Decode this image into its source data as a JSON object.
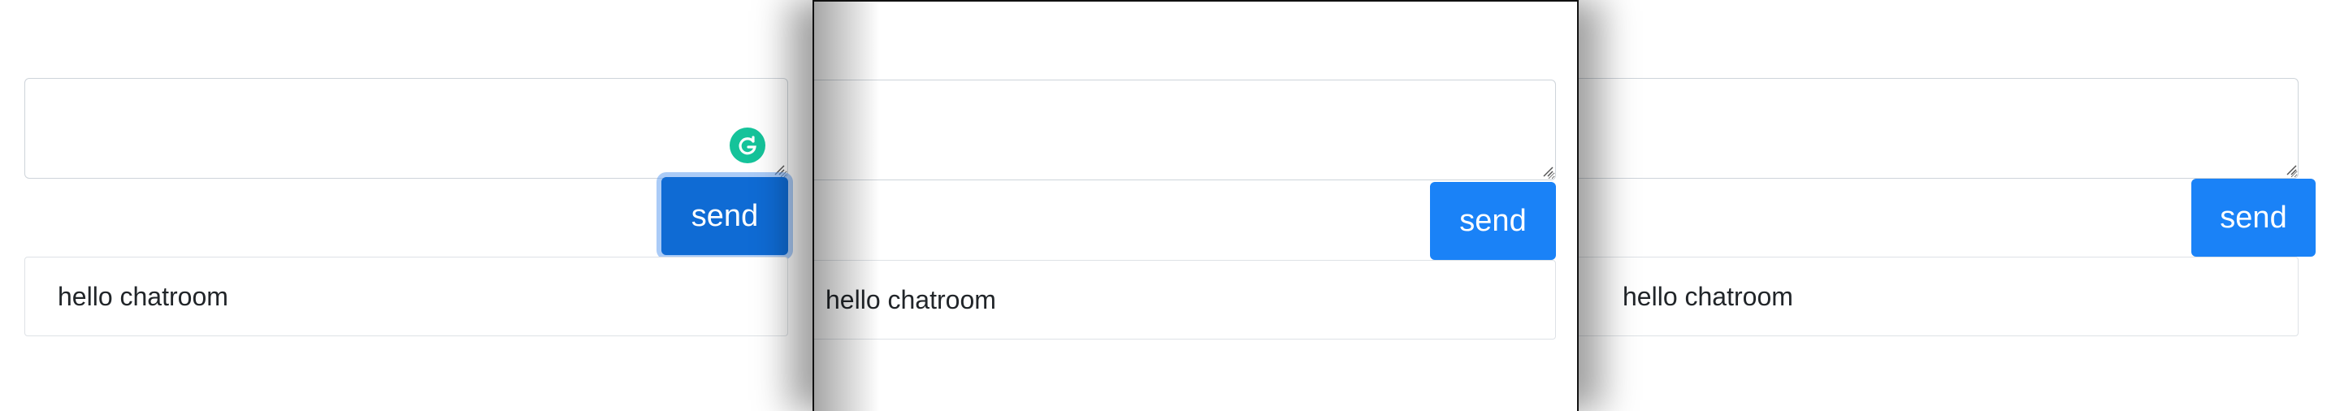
{
  "panels": [
    {
      "send_label": "send",
      "message": "hello chatroom",
      "input_value": "",
      "send_state": "focused"
    },
    {
      "send_label": "send",
      "message": "hello chatroom",
      "input_value": ""
    },
    {
      "send_label": "send",
      "message": "hello chatroom",
      "input_value": ""
    }
  ],
  "colors": {
    "send_button": "#1a82f7",
    "send_button_focused": "#0f6bd4",
    "grammarly_badge": "#15c39a",
    "border": "#ced4da"
  },
  "icons": {
    "grammarly": "grammarly-g-icon",
    "resize": "resize-grip-icon"
  }
}
